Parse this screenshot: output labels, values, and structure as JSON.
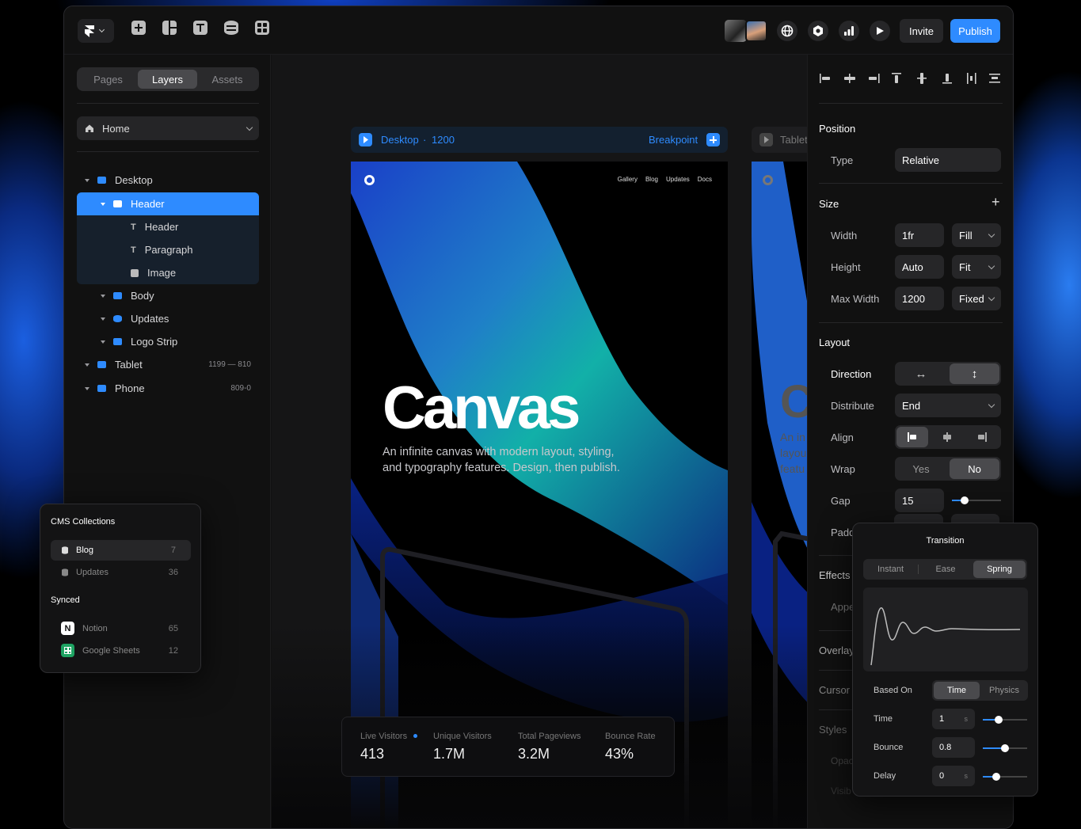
{
  "toolbar": {
    "invite_label": "Invite",
    "publish_label": "Publish",
    "accent": "#2e8bff"
  },
  "left_panel": {
    "tabs": [
      {
        "label": "Pages"
      },
      {
        "label": "Layers"
      },
      {
        "label": "Assets"
      }
    ],
    "page_select": "Home",
    "layers": [
      {
        "label": "Desktop",
        "count": ""
      },
      {
        "label": "Header",
        "count": ""
      },
      {
        "label": "Header",
        "count": ""
      },
      {
        "label": "Paragraph",
        "count": ""
      },
      {
        "label": "Image",
        "count": ""
      },
      {
        "label": "Body",
        "count": ""
      },
      {
        "label": "Updates",
        "count": ""
      },
      {
        "label": "Logo Strip",
        "count": ""
      },
      {
        "label": "Tablet",
        "count": "1199 — 810"
      },
      {
        "label": "Phone",
        "count": "809-0"
      }
    ]
  },
  "breakpoint_bar": {
    "name": "Desktop",
    "separator": "·",
    "width": "1200",
    "action": "Breakpoint",
    "next": "Tablet"
  },
  "preview": {
    "nav": [
      "Gallery",
      "Blog",
      "Updates",
      "Docs"
    ],
    "title": "Canvas",
    "subtitle_line1": "An infinite canvas with modern layout, styling,",
    "subtitle_line2": "and typography features. Design, then publish.",
    "tablet_title": "C",
    "tablet_text": [
      "An in",
      "layou",
      "featu"
    ],
    "stats": [
      {
        "label": "Live Visitors",
        "value": "413"
      },
      {
        "label": "Unique Visitors",
        "value": "1.7M"
      },
      {
        "label": "Total Pageviews",
        "value": "3.2M"
      },
      {
        "label": "Bounce Rate",
        "value": "43%"
      }
    ]
  },
  "cms": {
    "title": "CMS Collections",
    "collections": [
      {
        "label": "Blog",
        "count": "7"
      },
      {
        "label": "Updates",
        "count": "36"
      }
    ],
    "synced_title": "Synced",
    "synced": [
      {
        "label": "Notion",
        "count": "65"
      },
      {
        "label": "Google Sheets",
        "count": "12"
      }
    ]
  },
  "properties": {
    "position": {
      "title": "Position",
      "type_label": "Type",
      "type_value": "Relative"
    },
    "size": {
      "title": "Size",
      "add": "+",
      "width_label": "Width",
      "width_value": "1fr",
      "width_mode": "Fill",
      "height_label": "Height",
      "height_value": "Auto",
      "height_mode": "Fit",
      "maxw_label": "Max Width",
      "maxw_value": "1200",
      "maxw_mode": "Fixed"
    },
    "layout": {
      "title": "Layout",
      "direction_label": "Direction",
      "distribute_label": "Distribute",
      "distribute_value": "End",
      "align_label": "Align",
      "wrap_label": "Wrap",
      "wrap_yes": "Yes",
      "wrap_no": "No",
      "gap_label": "Gap",
      "gap_value": "15",
      "gap_slider": 0.25,
      "padding_label": "Paddi"
    },
    "effects": "Effects",
    "appear": "Appe",
    "overlay": "Overlay",
    "cursor": "Cursor",
    "styles": "Styles",
    "opacity": "Opac",
    "visible": "Visib"
  },
  "transition": {
    "title": "Transition",
    "tabs": [
      "Instant",
      "Ease",
      "Spring"
    ],
    "based_on_label": "Based On",
    "based_on_options": [
      "Time",
      "Physics"
    ],
    "time_label": "Time",
    "time_value": "1",
    "time_unit": "s",
    "time_slider": 0.35,
    "bounce_label": "Bounce",
    "bounce_value": "0.8",
    "bounce_slider": 0.5,
    "delay_label": "Delay",
    "delay_value": "0",
    "delay_unit": "s",
    "delay_slider": 0.3
  }
}
